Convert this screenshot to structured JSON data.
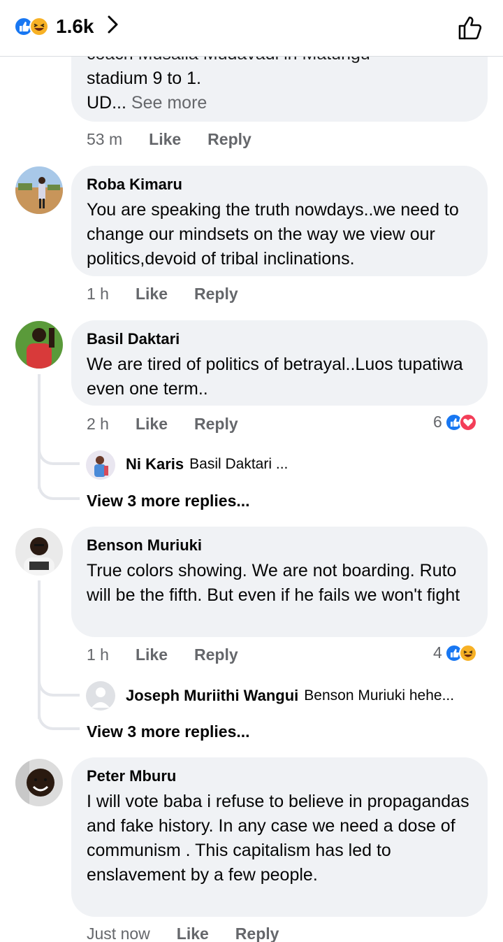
{
  "header": {
    "reaction_count": "1.6k",
    "icons": [
      "like-icon",
      "haha-icon",
      "chevron-right-icon",
      "thumbs-up-icon"
    ]
  },
  "comments": [
    {
      "text_lines": [
        "coach Musalia Mudavadi in Matungu",
        "stadium 9 to 1."
      ],
      "truncated_prefix": "UD...",
      "see_more": "See more",
      "time": "53 m",
      "like": "Like",
      "reply": "Reply"
    },
    {
      "author": "Roba Kimaru",
      "text": "You are speaking the truth nowdays..we need to change our mindsets on the way we view our politics,devoid of tribal inclinations.",
      "time": "1 h",
      "like": "Like",
      "reply": "Reply"
    },
    {
      "author": "Basil Daktari",
      "text": "We are tired of politics of betrayal..Luos tupatiwa even one term..",
      "time": "2 h",
      "like": "Like",
      "reply": "Reply",
      "reactions": "6",
      "reply_preview": {
        "author": "Ni Karis",
        "text": "Basil Daktari ..."
      },
      "more_replies": "View 3 more replies..."
    },
    {
      "author": "Benson Muriuki",
      "text": "True colors showing. We are not boarding. Ruto will be the fifth. But even if he fails we won't fight",
      "time": "1 h",
      "like": "Like",
      "reply": "Reply",
      "reactions": "4",
      "reply_preview": {
        "author": "Joseph Muriithi Wangui",
        "text": "Benson Muriuki hehe..."
      },
      "more_replies": "View 3 more replies..."
    },
    {
      "author": "Peter Mburu",
      "text": "I will vote baba i refuse to believe in propagandas and fake history. In any case we need a dose of communism . This capitalism has led to enslavement by a few people.",
      "time": "Just now",
      "like": "Like",
      "reply": "Reply"
    }
  ],
  "colors": {
    "bubble": "#f0f2f5",
    "secondary_text": "#65676b",
    "like_blue": "#1877f2",
    "love_red": "#f33e58",
    "haha_yellow": "#f7b125",
    "thread_line": "#e4e6eb"
  }
}
